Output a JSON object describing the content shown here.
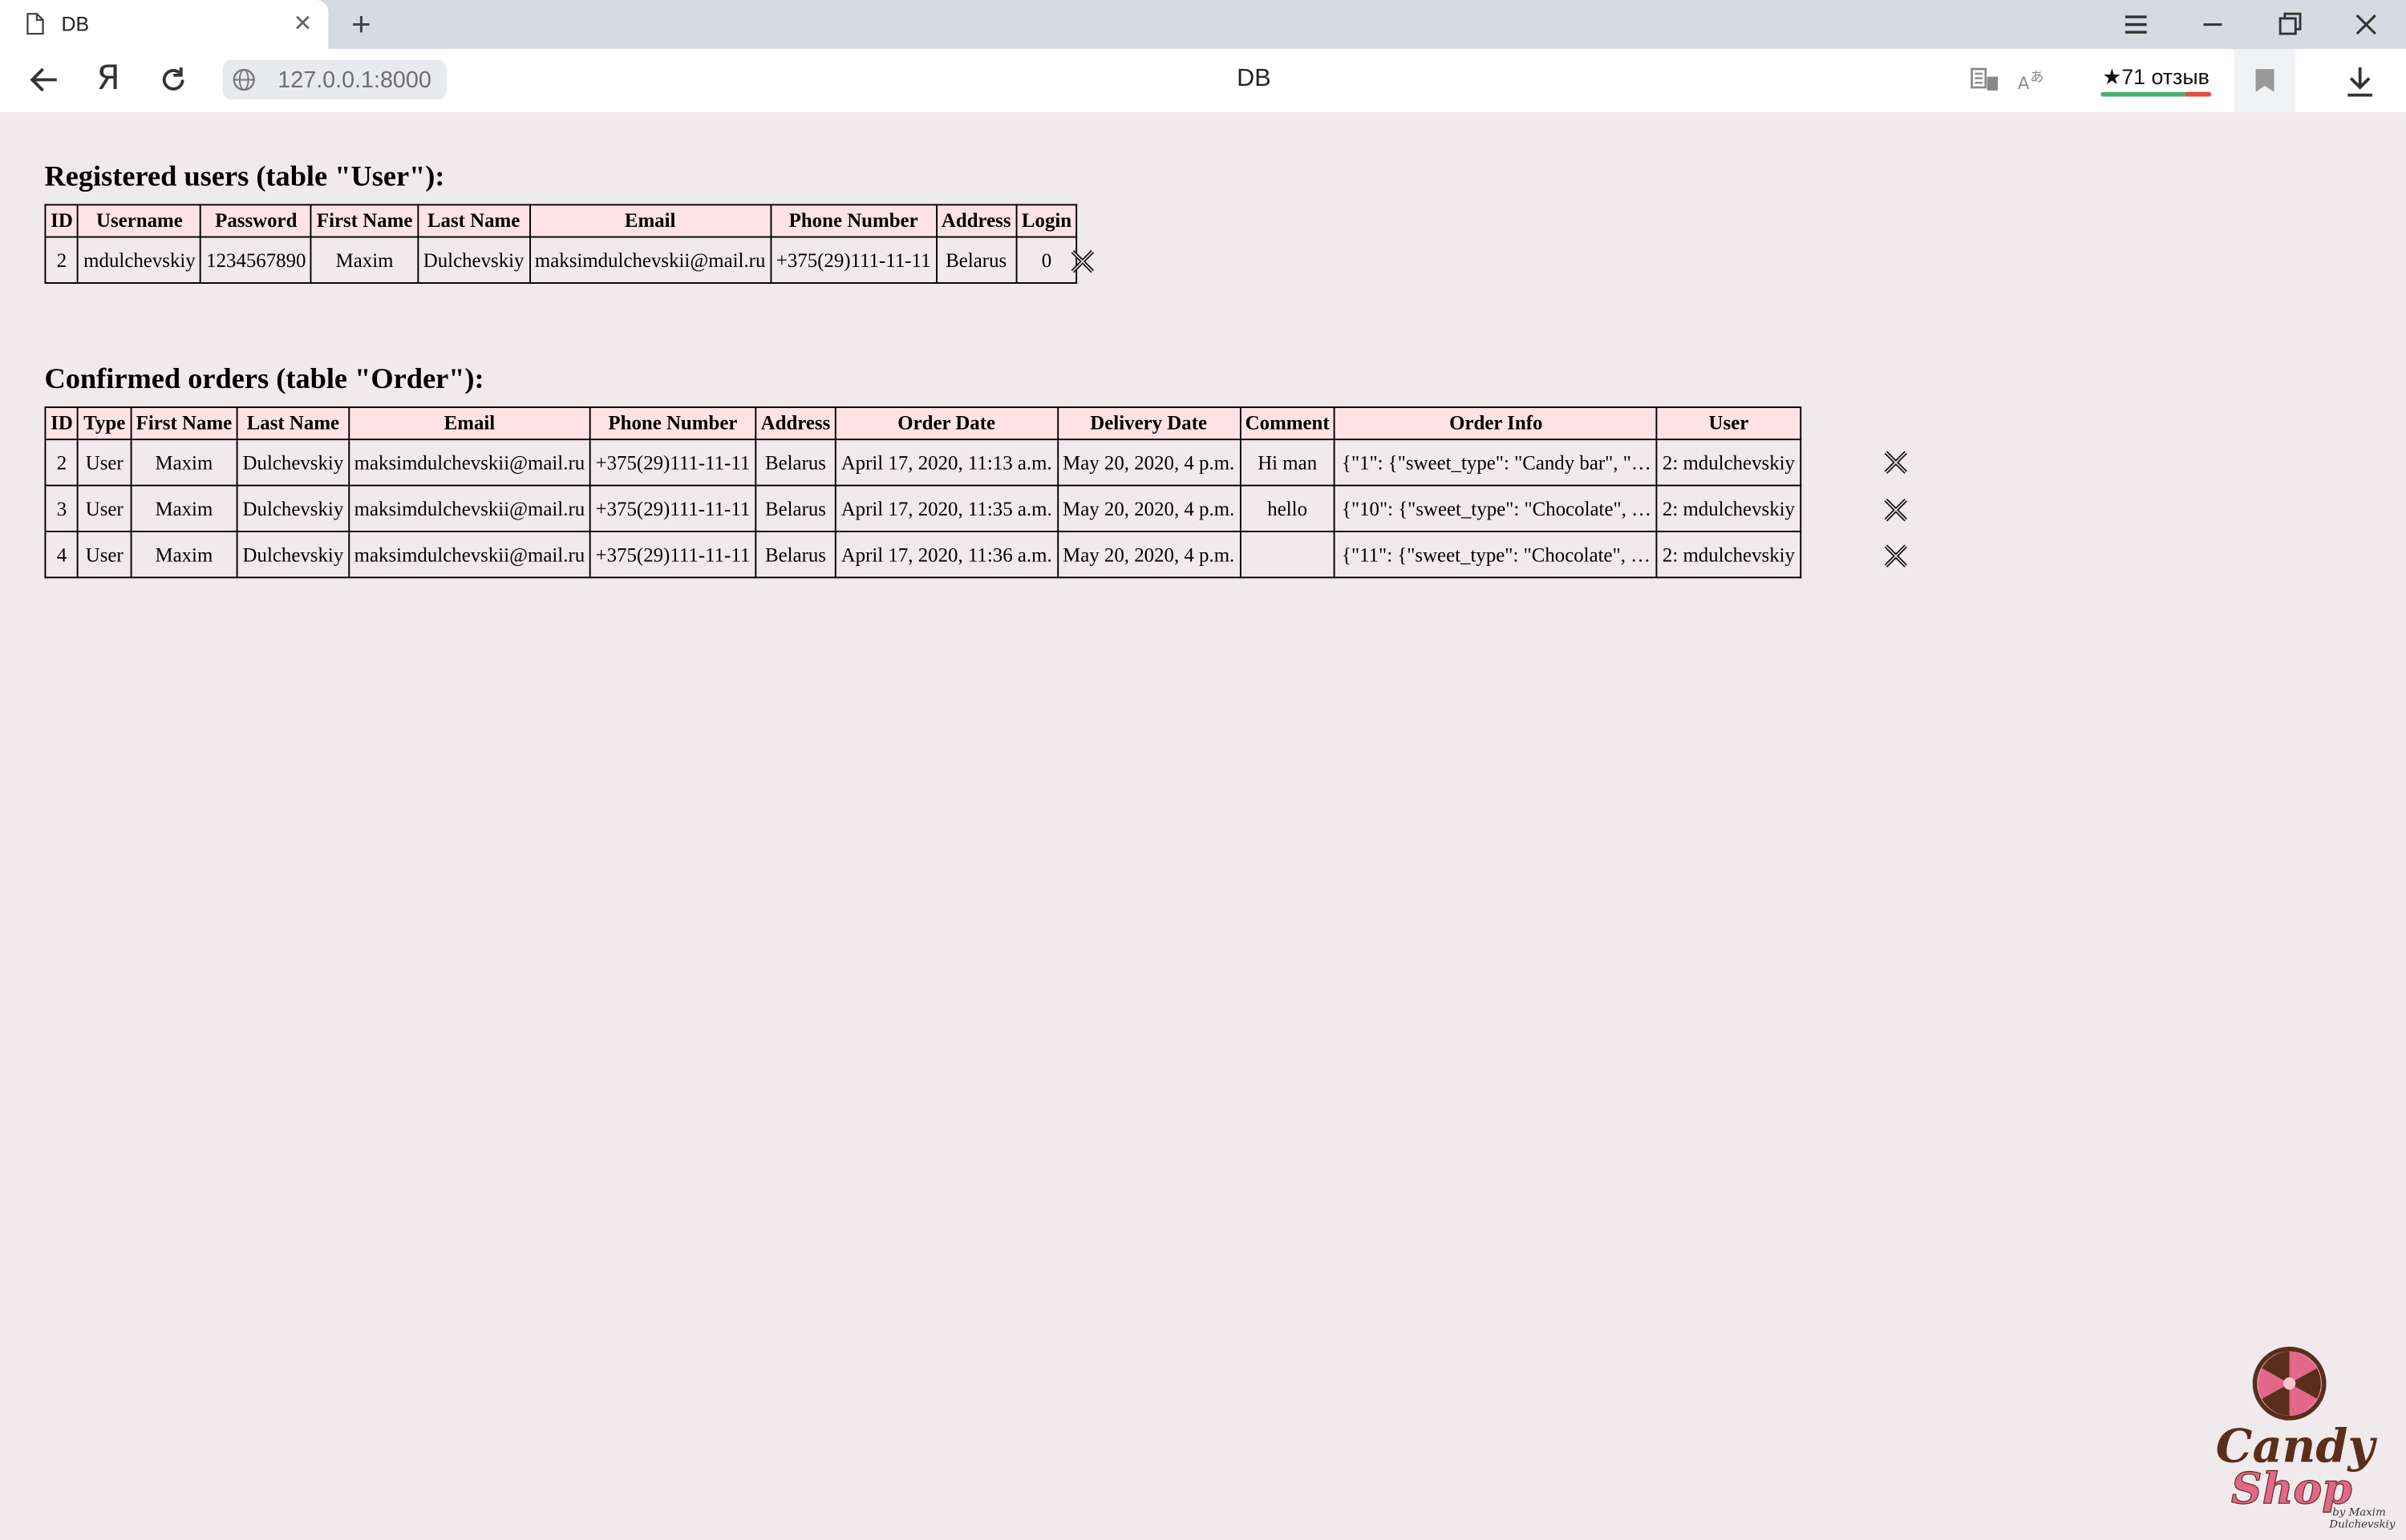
{
  "browser": {
    "tab_title": "DB",
    "url": "127.0.0.1:8000",
    "page_title": "DB",
    "yandex_letter": "Я",
    "rating_label": "★71 отзыв"
  },
  "users_section": {
    "heading": "Registered users (table \"User\"):",
    "columns": [
      "ID",
      "Username",
      "Password",
      "First Name",
      "Last Name",
      "Email",
      "Phone Number",
      "Address",
      "Login"
    ],
    "rows": [
      [
        "2",
        "mdulchevskiy",
        "1234567890",
        "Maxim",
        "Dulchevskiy",
        "maksimdulchevskii@mail.ru",
        "+375(29)111-11-11",
        "Belarus",
        "0"
      ]
    ]
  },
  "orders_section": {
    "heading": "Confirmed orders (table \"Order\"):",
    "columns": [
      "ID",
      "Type",
      "First Name",
      "Last Name",
      "Email",
      "Phone Number",
      "Address",
      "Order Date",
      "Delivery Date",
      "Comment",
      "Order Info",
      "User"
    ],
    "rows": [
      [
        "2",
        "User",
        "Maxim",
        "Dulchevskiy",
        "maksimdulchevskii@mail.ru",
        "+375(29)111-11-11",
        "Belarus",
        "April 17, 2020, 11:13 a.m.",
        "May 20, 2020, 4 p.m.",
        "Hi man",
        "{\"1\": {\"sweet_type\": \"Candy bar\", \"sw…",
        "2: mdulchevskiy"
      ],
      [
        "3",
        "User",
        "Maxim",
        "Dulchevskiy",
        "maksimdulchevskii@mail.ru",
        "+375(29)111-11-11",
        "Belarus",
        "April 17, 2020, 11:35 a.m.",
        "May 20, 2020, 4 p.m.",
        "hello",
        "{\"10\": {\"sweet_type\": \"Chocolate\", \"s…",
        "2: mdulchevskiy"
      ],
      [
        "4",
        "User",
        "Maxim",
        "Dulchevskiy",
        "maksimdulchevskii@mail.ru",
        "+375(29)111-11-11",
        "Belarus",
        "April 17, 2020, 11:36 a.m.",
        "May 20, 2020, 4 p.m.",
        "",
        "{\"11\": {\"sweet_type\": \"Chocolate\", \"s…",
        "2: mdulchevskiy"
      ]
    ]
  },
  "logo": {
    "line1": "Candy",
    "line2": "Shop",
    "byline1": "by Maxim",
    "byline2": "Dulchevskiy"
  },
  "icons": [
    "doc-icon",
    "close-icon",
    "plus-icon",
    "menu-icon",
    "minimize-icon",
    "restore-icon",
    "window-close-icon",
    "back-arrow-icon",
    "reload-icon",
    "globe-icon",
    "translate-icon",
    "reader-icon",
    "bookmark-icon",
    "download-icon",
    "delete-x-icon"
  ],
  "colors": {
    "page_bg": "#f0eaed",
    "header_bg": "#fde2e7",
    "tabbar_bg": "#d6dae3",
    "logo_brown": "#5a2e1c",
    "logo_pink": "#e26788"
  }
}
